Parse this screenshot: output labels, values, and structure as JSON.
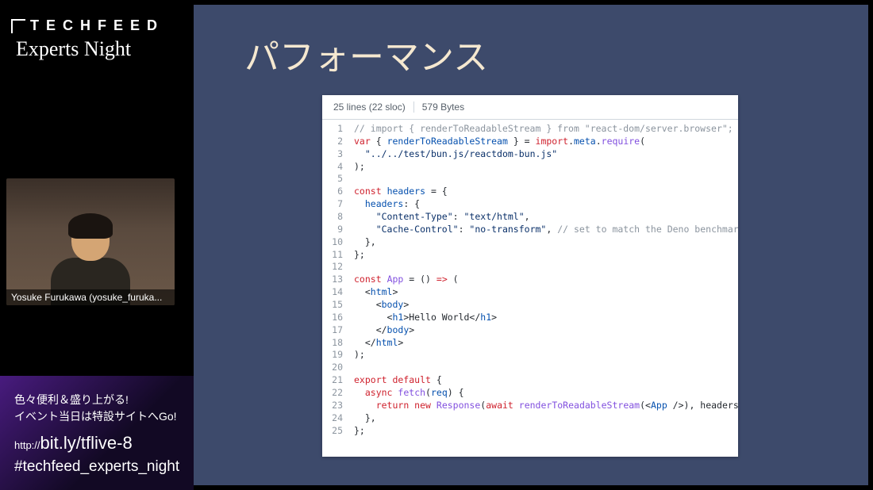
{
  "logo": {
    "main": "TECHFEED",
    "sub": "Experts Night"
  },
  "webcam": {
    "name": "Yosuke Furukawa (yosuke_furuka..."
  },
  "promo": {
    "line1": "色々便利＆盛り上がる!",
    "line2": "イベント当日は特設サイトへGo!",
    "url_prefix": "http://",
    "url_main": "bit.ly/tflive-8",
    "hashtag": "#techfeed_experts_night"
  },
  "slide": {
    "title": "パフォーマンス",
    "code_header": {
      "lines": "25 lines (22 sloc)",
      "bytes": "579 Bytes"
    },
    "code": [
      [
        {
          "t": "comment",
          "v": "// import { renderToReadableStream } from \"react-dom/server.browser\";"
        }
      ],
      [
        {
          "t": "keyword",
          "v": "var"
        },
        {
          "t": "default",
          "v": " { "
        },
        {
          "t": "prop",
          "v": "renderToReadableStream"
        },
        {
          "t": "default",
          "v": " } = "
        },
        {
          "t": "keyword",
          "v": "import"
        },
        {
          "t": "default",
          "v": "."
        },
        {
          "t": "prop",
          "v": "meta"
        },
        {
          "t": "default",
          "v": "."
        },
        {
          "t": "func",
          "v": "require"
        },
        {
          "t": "default",
          "v": "("
        }
      ],
      [
        {
          "t": "default",
          "v": "  "
        },
        {
          "t": "string",
          "v": "\"../../test/bun.js/reactdom-bun.js\""
        }
      ],
      [
        {
          "t": "default",
          "v": ");"
        }
      ],
      [
        {
          "t": "default",
          "v": ""
        }
      ],
      [
        {
          "t": "keyword",
          "v": "const"
        },
        {
          "t": "default",
          "v": " "
        },
        {
          "t": "prop",
          "v": "headers"
        },
        {
          "t": "default",
          "v": " = {"
        }
      ],
      [
        {
          "t": "default",
          "v": "  "
        },
        {
          "t": "prop",
          "v": "headers"
        },
        {
          "t": "default",
          "v": ": {"
        }
      ],
      [
        {
          "t": "default",
          "v": "    "
        },
        {
          "t": "string",
          "v": "\"Content-Type\""
        },
        {
          "t": "default",
          "v": ": "
        },
        {
          "t": "string",
          "v": "\"text/html\""
        },
        {
          "t": "default",
          "v": ","
        }
      ],
      [
        {
          "t": "default",
          "v": "    "
        },
        {
          "t": "string",
          "v": "\"Cache-Control\""
        },
        {
          "t": "default",
          "v": ": "
        },
        {
          "t": "string",
          "v": "\"no-transform\""
        },
        {
          "t": "default",
          "v": ", "
        },
        {
          "t": "comment",
          "v": "// set to match the Deno benchmark, which requ"
        }
      ],
      [
        {
          "t": "default",
          "v": "  },"
        }
      ],
      [
        {
          "t": "default",
          "v": "};"
        }
      ],
      [
        {
          "t": "default",
          "v": ""
        }
      ],
      [
        {
          "t": "keyword",
          "v": "const"
        },
        {
          "t": "default",
          "v": " "
        },
        {
          "t": "func",
          "v": "App"
        },
        {
          "t": "default",
          "v": " = () "
        },
        {
          "t": "keyword",
          "v": "=>"
        },
        {
          "t": "default",
          "v": " ("
        }
      ],
      [
        {
          "t": "default",
          "v": "  <"
        },
        {
          "t": "prop",
          "v": "html"
        },
        {
          "t": "default",
          "v": ">"
        }
      ],
      [
        {
          "t": "default",
          "v": "    <"
        },
        {
          "t": "prop",
          "v": "body"
        },
        {
          "t": "default",
          "v": ">"
        }
      ],
      [
        {
          "t": "default",
          "v": "      <"
        },
        {
          "t": "prop",
          "v": "h1"
        },
        {
          "t": "default",
          "v": ">Hello World</"
        },
        {
          "t": "prop",
          "v": "h1"
        },
        {
          "t": "default",
          "v": ">"
        }
      ],
      [
        {
          "t": "default",
          "v": "    </"
        },
        {
          "t": "prop",
          "v": "body"
        },
        {
          "t": "default",
          "v": ">"
        }
      ],
      [
        {
          "t": "default",
          "v": "  </"
        },
        {
          "t": "prop",
          "v": "html"
        },
        {
          "t": "default",
          "v": ">"
        }
      ],
      [
        {
          "t": "default",
          "v": ");"
        }
      ],
      [
        {
          "t": "default",
          "v": ""
        }
      ],
      [
        {
          "t": "keyword",
          "v": "export default"
        },
        {
          "t": "default",
          "v": " {"
        }
      ],
      [
        {
          "t": "default",
          "v": "  "
        },
        {
          "t": "keyword",
          "v": "async"
        },
        {
          "t": "default",
          "v": " "
        },
        {
          "t": "func",
          "v": "fetch"
        },
        {
          "t": "default",
          "v": "("
        },
        {
          "t": "prop",
          "v": "req"
        },
        {
          "t": "default",
          "v": ") {"
        }
      ],
      [
        {
          "t": "default",
          "v": "    "
        },
        {
          "t": "keyword",
          "v": "return new"
        },
        {
          "t": "default",
          "v": " "
        },
        {
          "t": "func",
          "v": "Response"
        },
        {
          "t": "default",
          "v": "("
        },
        {
          "t": "keyword",
          "v": "await"
        },
        {
          "t": "default",
          "v": " "
        },
        {
          "t": "func",
          "v": "renderToReadableStream"
        },
        {
          "t": "default",
          "v": "(<"
        },
        {
          "t": "prop",
          "v": "App"
        },
        {
          "t": "default",
          "v": " />), headers);"
        }
      ],
      [
        {
          "t": "default",
          "v": "  },"
        }
      ],
      [
        {
          "t": "default",
          "v": "};"
        }
      ]
    ]
  }
}
